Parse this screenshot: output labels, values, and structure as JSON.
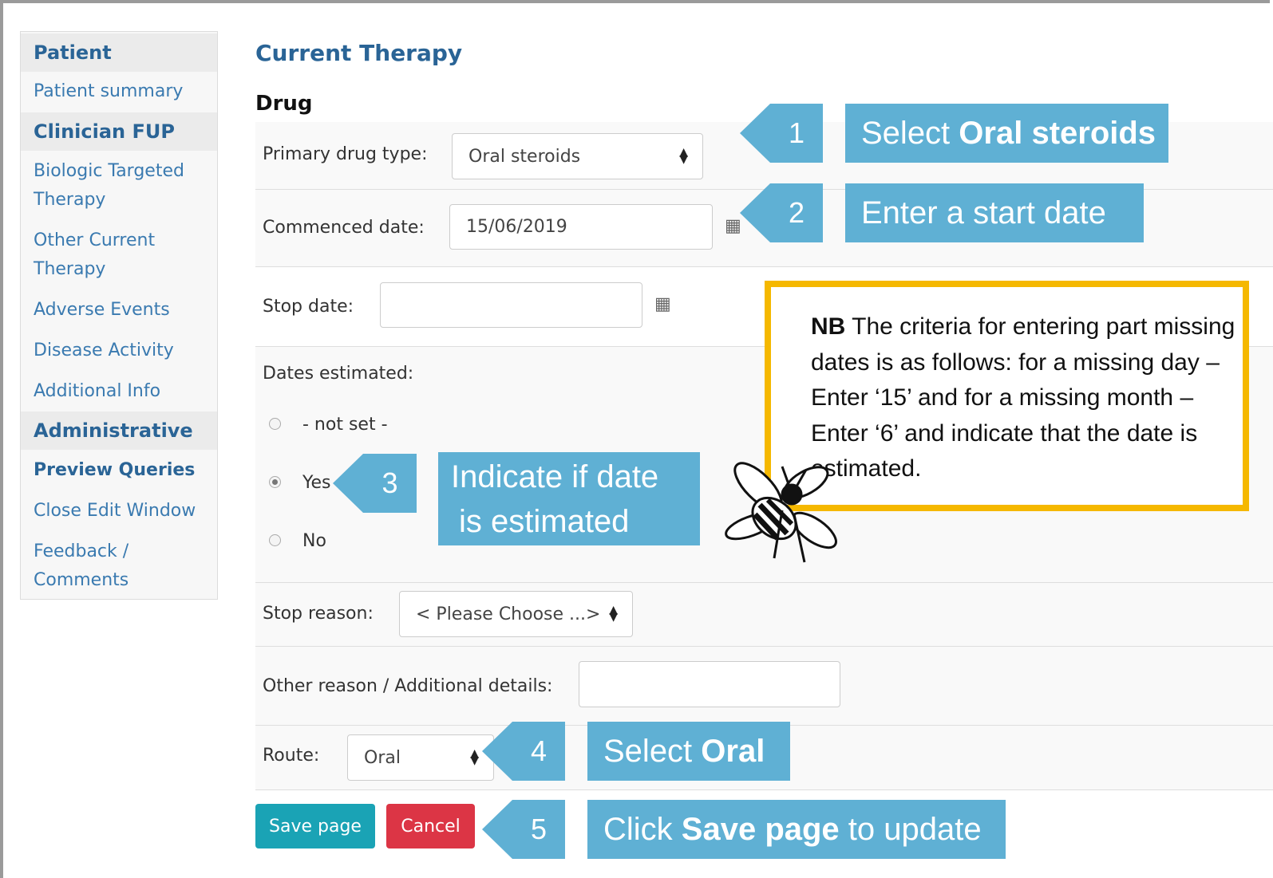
{
  "sidebar": {
    "patient_header": "Patient",
    "patient_summary": "Patient summary",
    "clinician_header": "Clinician FUP",
    "biologic_line1": "Biologic Targeted",
    "biologic_line2": "Therapy",
    "other_line1": "Other Current",
    "other_line2": "Therapy",
    "adverse_events": "Adverse Events",
    "disease_activity": "Disease Activity",
    "additional_info": "Additional Info",
    "admin_header": "Administrative",
    "preview_queries": "Preview Queries",
    "close_edit": "Close Edit Window",
    "feedback_line1": "Feedback /",
    "feedback_line2": "Comments"
  },
  "main": {
    "title": "Current Therapy",
    "section": "Drug",
    "primary_drug_label": "Primary drug type:",
    "primary_drug_value": "Oral steroids",
    "commenced_label": "Commenced date:",
    "commenced_value": "15/06/2019",
    "stop_date_label": "Stop date:",
    "stop_date_value": "",
    "dates_estimated_label": "Dates estimated:",
    "radio_not_set": "- not set -",
    "radio_yes": "Yes",
    "radio_no": "No",
    "stop_reason_label": "Stop reason:",
    "stop_reason_value": "< Please Choose ...>",
    "other_reason_label": "Other reason / Additional details:",
    "other_reason_value": "",
    "route_label": "Route:",
    "route_value": "Oral",
    "save_button": "Save page",
    "cancel_button": "Cancel"
  },
  "callouts": {
    "n1": "1",
    "c1_pre": "Select ",
    "c1_bold": "Oral steroids",
    "n2": "2",
    "c2": "Enter a start date",
    "n3": "3",
    "c3_line1": "Indicate if date",
    "c3_line2": "is estimated",
    "n4": "4",
    "c4_pre": "Select ",
    "c4_bold": "Oral",
    "n5": "5",
    "c5_pre": "Click ",
    "c5_bold": "Save page",
    "c5_post": " to update"
  },
  "note": {
    "bold": "NB",
    "text": " The criteria for entering part missing dates is as follows: for a missing day – Enter ‘15’ and for a missing month – Enter ‘6’ and indicate that the date is estimated."
  },
  "colors": {
    "callout": "#5fb0d4",
    "note_border": "#f5b800",
    "save_button": "#1aa3b5",
    "cancel_button": "#dc3545",
    "link": "#3a7ab0"
  },
  "icons": {
    "calendar": "calendar-icon",
    "select_arrow": "updown-caret-icon",
    "bee": "bee-icon"
  }
}
